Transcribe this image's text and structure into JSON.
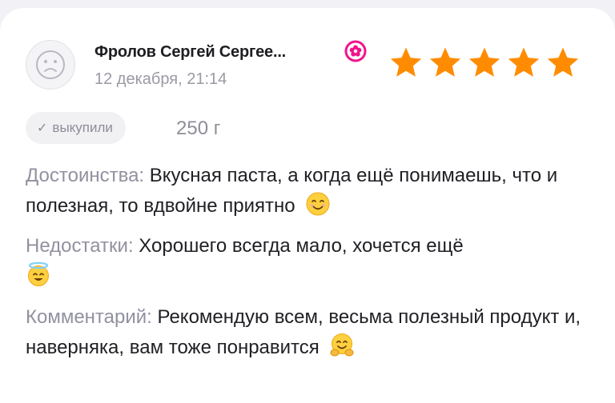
{
  "review": {
    "author": "Фролов Сергей Сергее...",
    "date": "12 декабря, 21:14",
    "rating": 5,
    "rating_max": 5,
    "purchase_badge": "выкупили",
    "variant": "250 г",
    "pros_label": "Достоинства:",
    "pros_text": " Вкусная паста, а когда ещё понимаешь, что и полезная, то вдвойне приятно",
    "cons_label": "Недостатки:",
    "cons_text": " Хорошего всегда мало, хочется ещё",
    "comment_label": "Комментарий:",
    "comment_text": " Рекомендую всем, весьма полезный продукт и, наверняка, вам тоже понравится"
  },
  "icons": {
    "avatar": "sad-face-icon",
    "badge": "flower-badge-icon",
    "star": "star-icon",
    "check": "checkmark-icon",
    "pros_emoji": "smiling-face-icon",
    "cons_emoji": "halo-face-icon",
    "comment_emoji": "hugging-face-icon"
  },
  "colors": {
    "star": "#ff8c00",
    "badge": "#f0148c",
    "label": "#9191a0",
    "text": "#1f1f24",
    "muted": "#9a9aa6",
    "chip_bg": "#f1f1f4"
  }
}
